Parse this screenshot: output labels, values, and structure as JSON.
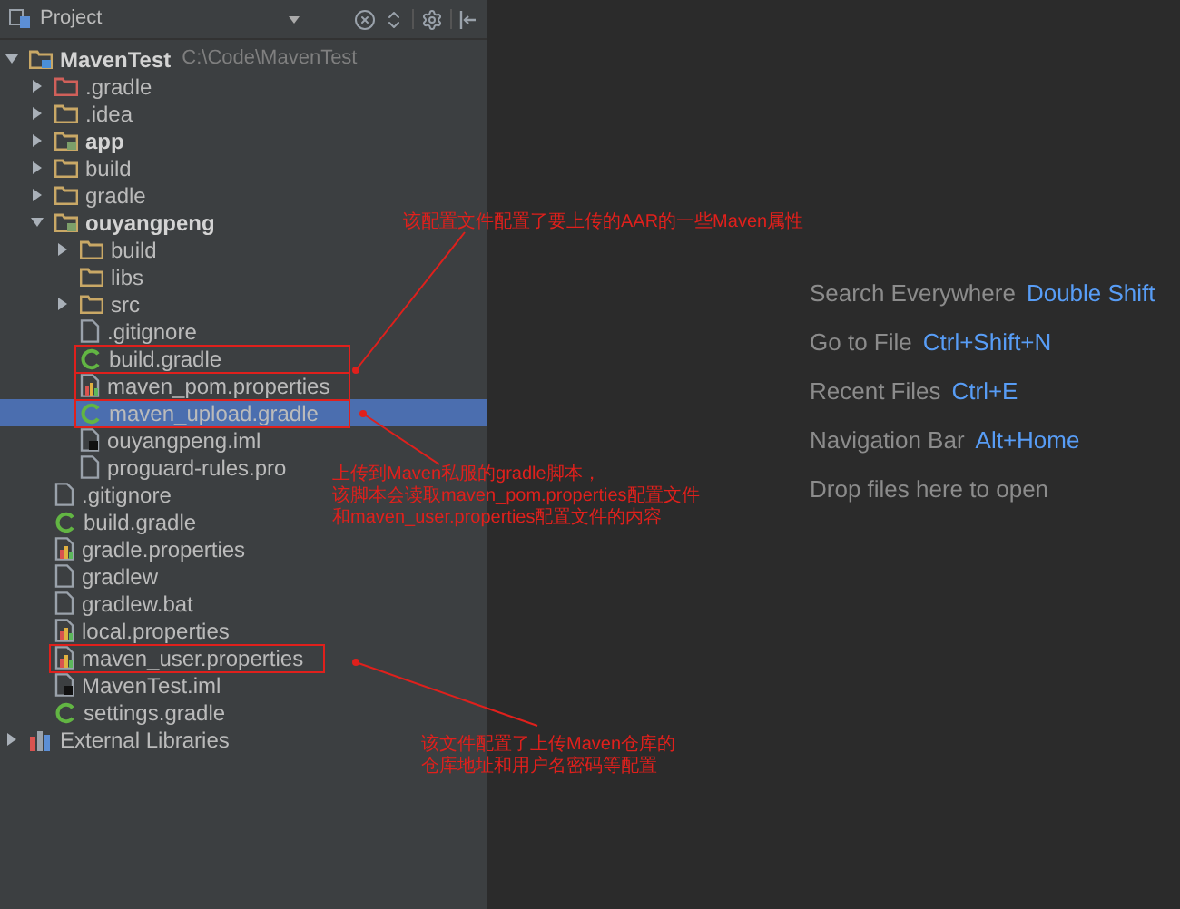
{
  "panel": {
    "title": "Project"
  },
  "tree": [
    {
      "label": "MavenTest",
      "path": "C:\\Code\\MavenTest",
      "kind": "module",
      "bold": true,
      "expanded": true,
      "selected": false,
      "framed": false,
      "children": [
        {
          "label": ".gradle",
          "kind": "excluded-folder",
          "bold": false,
          "expanded": false,
          "selected": false,
          "framed": false
        },
        {
          "label": ".idea",
          "kind": "folder",
          "bold": false,
          "expanded": false,
          "selected": false,
          "framed": false
        },
        {
          "label": "app",
          "kind": "module-folder",
          "bold": true,
          "expanded": false,
          "selected": false,
          "framed": false
        },
        {
          "label": "build",
          "kind": "folder",
          "bold": false,
          "expanded": false,
          "selected": false,
          "framed": false
        },
        {
          "label": "gradle",
          "kind": "folder",
          "bold": false,
          "expanded": false,
          "selected": false,
          "framed": false
        },
        {
          "label": "ouyangpeng",
          "kind": "module-folder",
          "bold": true,
          "expanded": true,
          "selected": false,
          "framed": false,
          "children": [
            {
              "label": "build",
              "kind": "folder",
              "bold": false,
              "expanded": false,
              "selected": false,
              "framed": false
            },
            {
              "label": "libs",
              "kind": "folder",
              "bold": false,
              "selected": false,
              "framed": false
            },
            {
              "label": "src",
              "kind": "folder",
              "bold": false,
              "expanded": false,
              "selected": false,
              "framed": false
            },
            {
              "label": ".gitignore",
              "kind": "file",
              "bold": false,
              "selected": false,
              "framed": false
            },
            {
              "label": "build.gradle",
              "kind": "gradle",
              "bold": false,
              "selected": false,
              "framed": true
            },
            {
              "label": "maven_pom.properties",
              "kind": "properties",
              "bold": false,
              "selected": false,
              "framed": true
            },
            {
              "label": "maven_upload.gradle",
              "kind": "gradle",
              "bold": false,
              "selected": true,
              "framed": true
            },
            {
              "label": "ouyangpeng.iml",
              "kind": "iml",
              "bold": false,
              "selected": false,
              "framed": false
            },
            {
              "label": "proguard-rules.pro",
              "kind": "file",
              "bold": false,
              "selected": false,
              "framed": false
            }
          ]
        },
        {
          "label": ".gitignore",
          "kind": "file",
          "bold": false,
          "selected": false,
          "framed": false
        },
        {
          "label": "build.gradle",
          "kind": "gradle",
          "bold": false,
          "selected": false,
          "framed": false
        },
        {
          "label": "gradle.properties",
          "kind": "properties",
          "bold": false,
          "selected": false,
          "framed": false
        },
        {
          "label": "gradlew",
          "kind": "file",
          "bold": false,
          "selected": false,
          "framed": false
        },
        {
          "label": "gradlew.bat",
          "kind": "file",
          "bold": false,
          "selected": false,
          "framed": false
        },
        {
          "label": "local.properties",
          "kind": "properties",
          "bold": false,
          "selected": false,
          "framed": false
        },
        {
          "label": "maven_user.properties",
          "kind": "properties",
          "bold": false,
          "selected": false,
          "framed": true
        },
        {
          "label": "MavenTest.iml",
          "kind": "iml",
          "bold": false,
          "selected": false,
          "framed": false
        },
        {
          "label": "settings.gradle",
          "kind": "gradle",
          "bold": false,
          "selected": false,
          "framed": false
        }
      ]
    },
    {
      "label": "External Libraries",
      "kind": "libraries",
      "bold": false,
      "expanded": false,
      "selected": false,
      "framed": false
    }
  ],
  "hints": [
    {
      "label": "Search Everywhere",
      "shortcut": "Double Shift"
    },
    {
      "label": "Go to File",
      "shortcut": "Ctrl+Shift+N"
    },
    {
      "label": "Recent Files",
      "shortcut": "Ctrl+E"
    },
    {
      "label": "Navigation Bar",
      "shortcut": "Alt+Home"
    },
    {
      "label": "Drop files here to open"
    }
  ],
  "annotations": [
    {
      "lines": [
        "该配置文件配置了要上传的AAR的一些Maven属性"
      ]
    },
    {
      "lines": [
        "上传到Maven私服的gradle脚本，",
        "该脚本会读取maven_pom.properties配置文件",
        "和maven_user.properties配置文件的内容"
      ]
    },
    {
      "lines": [
        "该文件配置了上传Maven仓库的",
        "仓库地址和用户名密码等配置"
      ]
    }
  ]
}
